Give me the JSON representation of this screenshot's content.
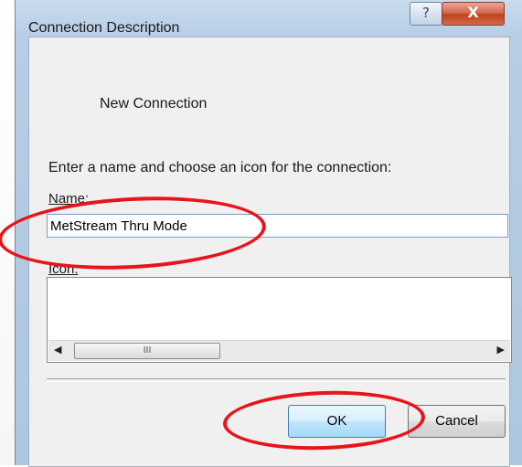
{
  "window": {
    "title": "Connection Description",
    "help_label": "?",
    "close_label": "X"
  },
  "dialog": {
    "header_title": "New Connection",
    "instruction": "Enter a name and choose an icon for the connection:",
    "name_label": "Name:",
    "name_value": "MetStream Thru Mode",
    "icon_label": "Icon:",
    "scrollbar": {
      "left_arrow": "◀",
      "thumb_grip": "III",
      "right_arrow": "▶"
    },
    "buttons": {
      "ok": "OK",
      "cancel": "Cancel"
    }
  },
  "colors": {
    "title_bar": "#b7cde4",
    "close_button": "#c2431f",
    "annotation_circle": "#e8141a"
  }
}
